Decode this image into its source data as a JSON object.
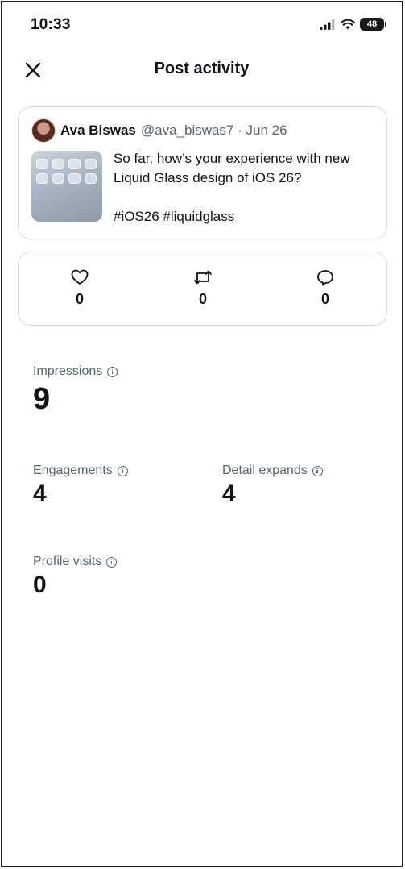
{
  "status_bar": {
    "time": "10:33",
    "battery": "48",
    "icons": [
      "signal-icon",
      "wifi-icon",
      "battery-icon"
    ]
  },
  "header": {
    "title": "Post activity",
    "close_icon": "close-icon"
  },
  "post": {
    "author_name": "Ava Biswas",
    "author_meta": "@ava_biswas7 · Jun 26",
    "text_line1": "So far, how’s your experience with new",
    "text_line2": "Liquid Glass design of iOS 26?",
    "hashtags": "#iOS26 #liquidglass"
  },
  "metrics": {
    "likes": "0",
    "reposts": "0",
    "replies": "0",
    "icons": [
      "heart-icon",
      "repost-icon",
      "reply-icon"
    ]
  },
  "stats": {
    "impressions_label": "Impressions",
    "impressions_value": "9",
    "engagements_label": "Engagements",
    "engagements_value": "4",
    "detail_expands_label": "Detail expands",
    "detail_expands_value": "4",
    "profile_visits_label": "Profile visits",
    "profile_visits_value": "0"
  },
  "colors": {
    "text_primary": "#0f1419",
    "text_secondary": "#536471",
    "border": "#d7dce0"
  }
}
